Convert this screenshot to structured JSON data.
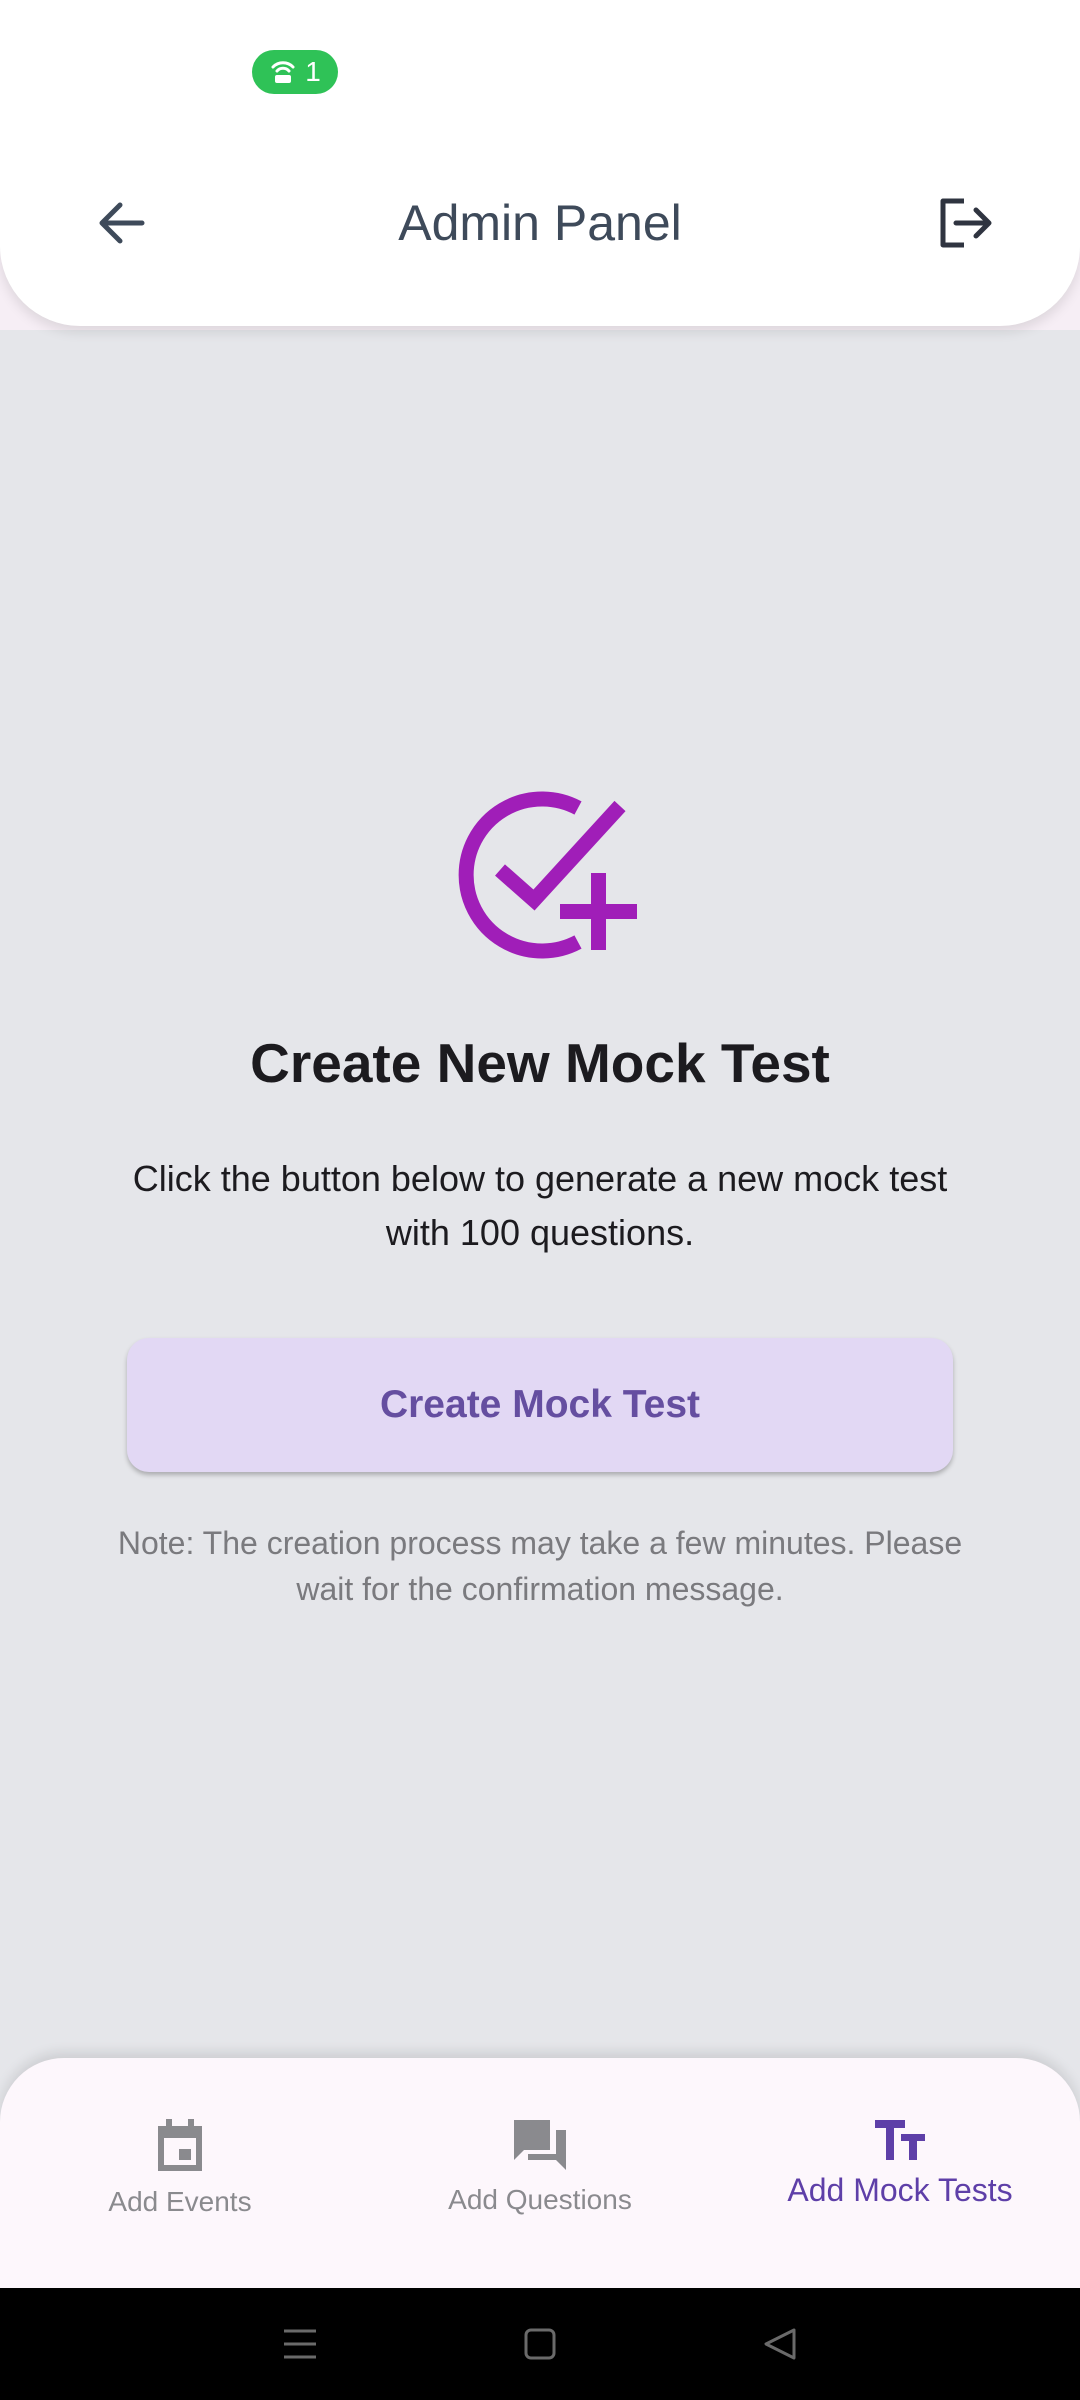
{
  "status_bar": {
    "hotspot_count": "1",
    "hotspot_icon": "hotspot-icon",
    "pill_color": "#2fc257"
  },
  "header": {
    "title": "Admin Panel",
    "back_icon": "arrow-left-icon",
    "logout_icon": "logout-icon"
  },
  "main": {
    "icon": "check-circle-plus-icon",
    "icon_color": "#a01eb8",
    "heading": "Create New Mock Test",
    "description": "Click the button below to generate a new mock test with 100 questions.",
    "button_label": "Create Mock Test",
    "note": "Note: The creation process may take a few minutes. Please wait for the confirmation message."
  },
  "bottom_nav": {
    "items": [
      {
        "label": "Add Events",
        "icon": "calendar-icon",
        "active": false
      },
      {
        "label": "Add Questions",
        "icon": "forum-icon",
        "active": false
      },
      {
        "label": "Add Mock Tests",
        "icon": "text-fields-icon",
        "active": true
      }
    ],
    "active_color": "#5e3fa8",
    "inactive_color": "#8a8a8e"
  },
  "system_nav": {
    "buttons": [
      "menu-icon",
      "home-icon",
      "back-triangle-icon"
    ]
  }
}
